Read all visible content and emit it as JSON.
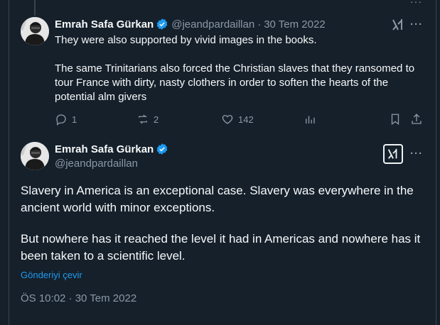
{
  "reply_tweet": {
    "author_name": "Emrah Safa Gürkan",
    "handle": "@jeandpardaillan",
    "separator": "·",
    "date": "30 Tem 2022",
    "paragraphs": [
      "They were also supported by vivid images in the books.",
      "The same Trinitarians also forced the Christian slaves that they ransomed to tour France with dirty, nasty clothers in order to soften the hearts of the potential alm givers"
    ],
    "actions": {
      "replies": "1",
      "reposts": "2",
      "likes": "142"
    }
  },
  "main_tweet": {
    "author_name": "Emrah Safa Gürkan",
    "handle": "@jeandpardaillan",
    "paragraphs": [
      "Slavery in America is an exceptional case. Slavery was everywhere in the ancient world with minor exceptions.",
      "But nowhere has it reached the level it had in Americas and nowhere has it been taken to a scientific level."
    ],
    "translate_label": "Gönderiyi çevir",
    "timestamp": "ÖS 10:02 · 30 Tem 2022"
  },
  "icons": {
    "verified": "verified-badge-icon",
    "grok": "grok-icon",
    "more": "more-icon"
  },
  "colors": {
    "background": "#15202b",
    "accent": "#1d9bf0",
    "muted": "#8b98a5"
  }
}
